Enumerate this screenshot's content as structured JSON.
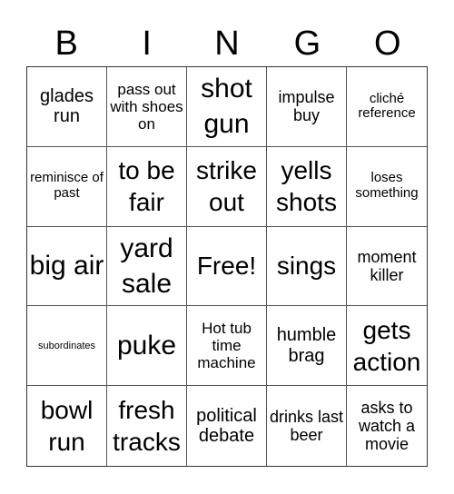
{
  "header": {
    "letters": [
      "B",
      "I",
      "N",
      "G",
      "O"
    ]
  },
  "cells": [
    "glades run",
    "pass out with shoes on",
    "shot gun",
    "impulse buy",
    "cliché reference",
    "reminisce of past",
    "to be fair",
    "strike out",
    "yells shots",
    "loses something",
    "big air",
    "yard sale",
    "Free!",
    "sings",
    "moment killer",
    "subordinates",
    "puke",
    "Hot tub time machine",
    "humble brag",
    "gets action",
    "bowl run",
    "fresh tracks",
    "political debate",
    "drinks last beer",
    "asks to watch a movie"
  ]
}
